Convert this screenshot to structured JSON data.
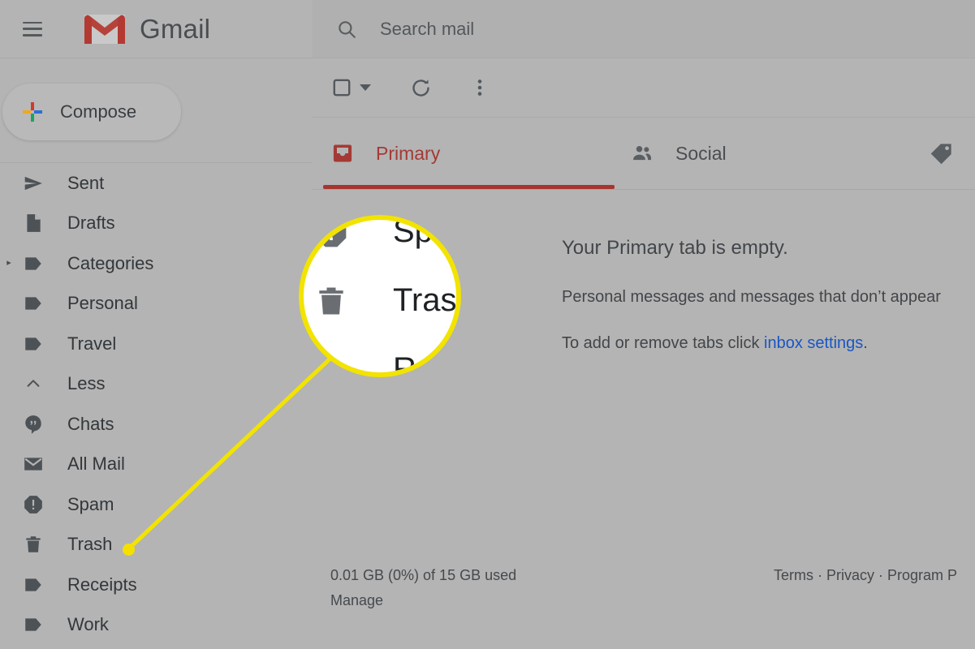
{
  "app": {
    "title": "Gmail",
    "background_color": "#b4b4b4"
  },
  "header": {
    "menu_icon": "hamburger-icon",
    "logo_icon": "gmail-logo-icon",
    "brand": "Gmail"
  },
  "search": {
    "icon": "search-icon",
    "placeholder": "Search mail",
    "value": ""
  },
  "sidebar": {
    "compose": {
      "label": "Compose",
      "icon": "plus-icon"
    },
    "items": [
      {
        "label": "Sent",
        "icon": "send-icon",
        "expander": ""
      },
      {
        "label": "Drafts",
        "icon": "draft-document-icon",
        "expander": ""
      },
      {
        "label": "Categories",
        "icon": "label-tag-icon",
        "expander": "▸"
      },
      {
        "label": "Personal",
        "icon": "label-tag-icon",
        "expander": ""
      },
      {
        "label": "Travel",
        "icon": "label-tag-icon",
        "expander": ""
      },
      {
        "label": "Less",
        "icon": "chevron-up-icon",
        "expander": ""
      },
      {
        "label": "Chats",
        "icon": "hangouts-chat-icon",
        "expander": ""
      },
      {
        "label": "All Mail",
        "icon": "envelope-icon",
        "expander": ""
      },
      {
        "label": "Spam",
        "icon": "spam-octagon-icon",
        "expander": ""
      },
      {
        "label": "Trash",
        "icon": "trash-icon",
        "expander": ""
      },
      {
        "label": "Receipts",
        "icon": "label-tag-icon",
        "expander": ""
      },
      {
        "label": "Work",
        "icon": "label-tag-icon",
        "expander": ""
      }
    ]
  },
  "toolbar": {
    "select_all_icon": "checkbox-empty-icon",
    "select_all_caret_icon": "chevron-down-icon",
    "refresh_icon": "refresh-icon",
    "more_icon": "more-vertical-icon"
  },
  "tabs": {
    "active": "Primary",
    "accent_color": "#a8342e",
    "items": [
      {
        "label": "Primary",
        "icon": "inbox-icon",
        "active": true
      },
      {
        "label": "Social",
        "icon": "people-icon",
        "active": false
      },
      {
        "label": "",
        "icon": "price-tag-icon",
        "active": false
      }
    ]
  },
  "empty_state": {
    "title": "Your Primary tab is empty.",
    "line2": "Personal messages and messages that don’t appear",
    "line3_prefix": "To add or remove tabs click ",
    "line3_link": "inbox settings",
    "line3_suffix": "."
  },
  "footer": {
    "storage": "0.01 GB (0%) of 15 GB used",
    "manage": "Manage",
    "links": "Terms · Privacy · Program P"
  },
  "callout": {
    "highlight_color": "#f2e300",
    "target_label": "Trash",
    "magnified": [
      {
        "label": "Spam",
        "icon": "spam-octagon-icon"
      },
      {
        "label": "Trash",
        "icon": "trash-icon"
      },
      {
        "label": "Receipts",
        "icon": "label-tag-icon"
      }
    ]
  }
}
